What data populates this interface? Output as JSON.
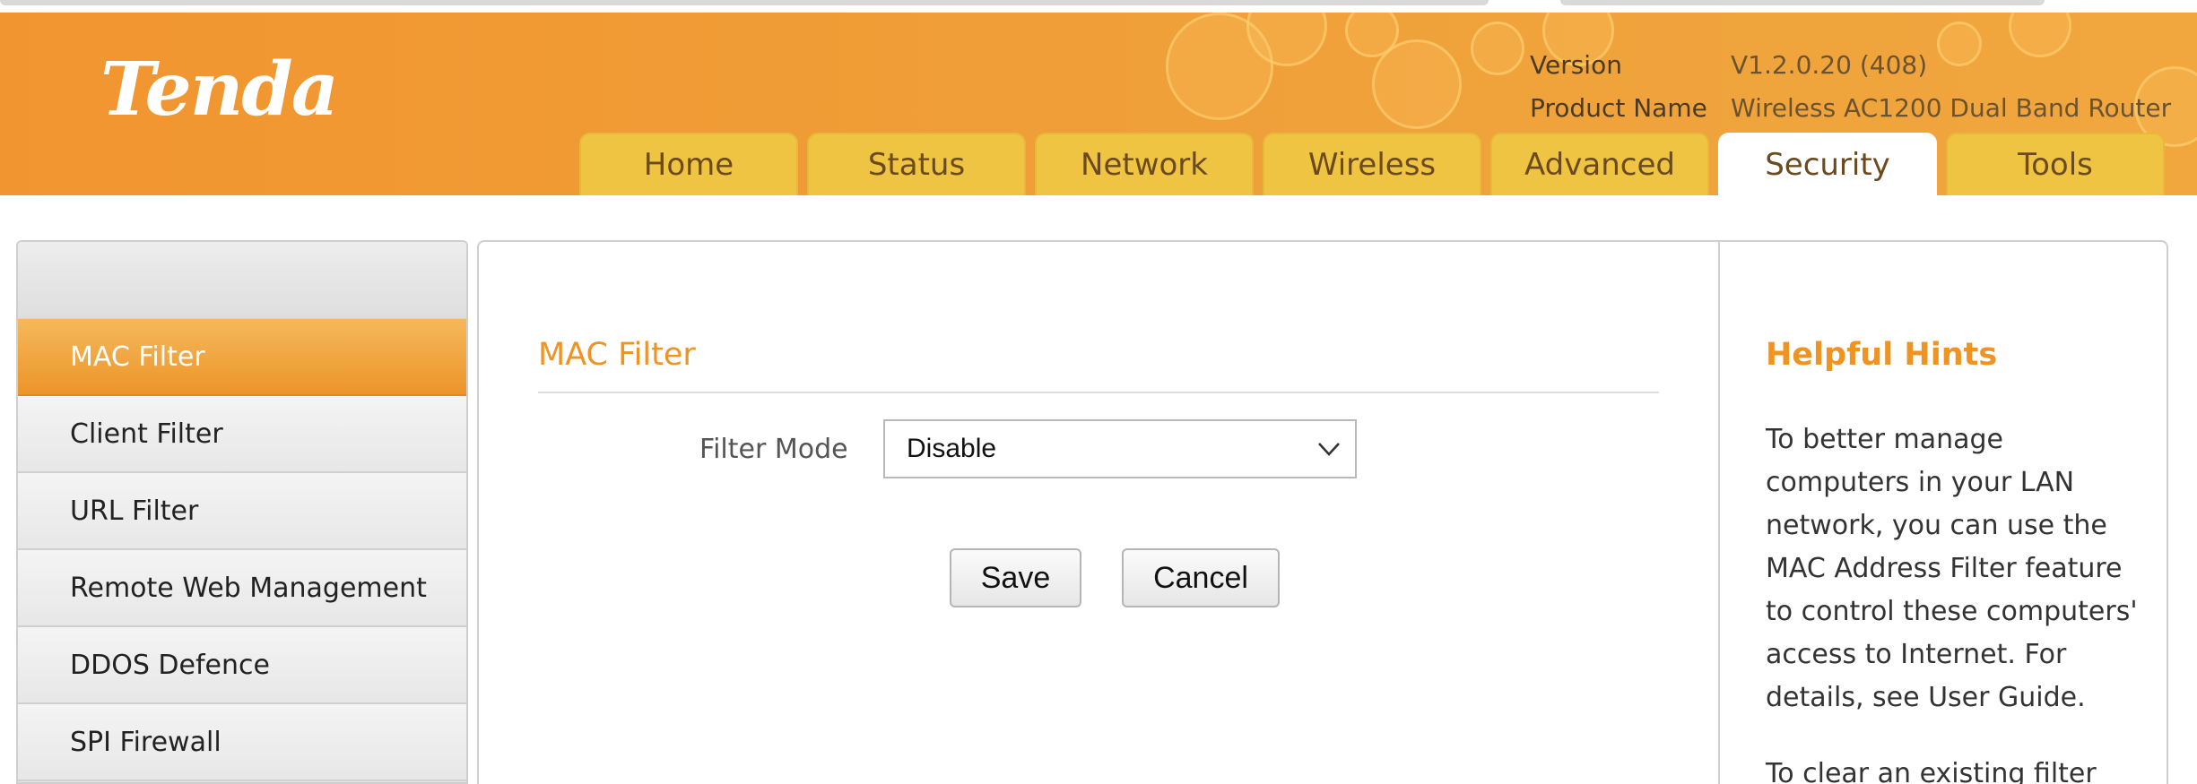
{
  "brand": {
    "logo_text": "Tenda"
  },
  "device_info": {
    "version_label": "Version",
    "version_value": "V1.2.0.20 (408)",
    "product_label": "Product Name",
    "product_value": "Wireless AC1200 Dual Band Router"
  },
  "nav": {
    "tabs": [
      {
        "label": "Home"
      },
      {
        "label": "Status"
      },
      {
        "label": "Network"
      },
      {
        "label": "Wireless"
      },
      {
        "label": "Advanced"
      },
      {
        "label": "Security",
        "active": true
      },
      {
        "label": "Tools"
      }
    ]
  },
  "sidebar": {
    "items": [
      {
        "label": "MAC Filter",
        "active": true
      },
      {
        "label": "Client Filter"
      },
      {
        "label": "URL Filter"
      },
      {
        "label": "Remote Web Management"
      },
      {
        "label": "DDOS Defence"
      },
      {
        "label": "SPI Firewall"
      }
    ]
  },
  "main": {
    "title": "MAC Filter",
    "filter_mode_label": "Filter Mode",
    "filter_mode_value": "Disable",
    "save_label": "Save",
    "cancel_label": "Cancel"
  },
  "hints": {
    "title": "Helpful Hints",
    "paragraph1": "To better manage computers in your LAN network, you can use the MAC Address Filter feature to control these computers' access to Internet. For details, see User Guide.",
    "paragraph2": "To clear an existing filter"
  },
  "colors": {
    "header_orange": "#f0a13a",
    "tab_yellow": "#efc443",
    "accent_orange": "#ef9323",
    "sidebar_active": "#ec952a"
  },
  "icons": {
    "select_arrow": "chevron-down-icon"
  }
}
